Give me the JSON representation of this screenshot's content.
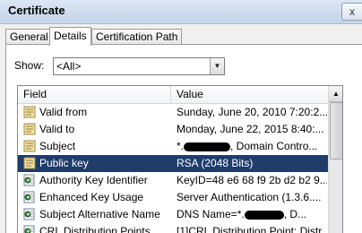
{
  "window": {
    "title": "Certificate",
    "close_label": "x"
  },
  "tabs": [
    {
      "label": "General"
    },
    {
      "label": "Details"
    },
    {
      "label": "Certification Path"
    }
  ],
  "show": {
    "label": "Show:",
    "selected": "<All>"
  },
  "list": {
    "columns": [
      "Field",
      "Value"
    ],
    "rows": [
      {
        "field": "Valid from",
        "value": "Sunday, June 20, 2010 7:20:2...",
        "icon": "cert-doc-icon"
      },
      {
        "field": "Valid to",
        "value": "Monday, June 22, 2015 8:40:...",
        "icon": "cert-doc-icon"
      },
      {
        "field": "Subject",
        "value_prefix": "*.",
        "value_suffix": ", Domain Contro...",
        "icon": "cert-doc-icon"
      },
      {
        "field": "Public key",
        "value": "RSA (2048 Bits)",
        "icon": "cert-doc-icon",
        "selected": true
      },
      {
        "field": "Authority Key Identifier",
        "value": "KeyID=48 e6 68 f9 2b d2 b2 9...",
        "icon": "extension-icon"
      },
      {
        "field": "Enhanced Key Usage",
        "value": "Server Authentication (1.3.6....",
        "icon": "extension-icon"
      },
      {
        "field": "Subject Alternative Name",
        "value_prefix": "DNS Name=*.",
        "value_suffix": ", D...",
        "icon": "extension-icon"
      },
      {
        "field": "CRL Distribution Points",
        "value": "[1]CRL Distribution Point: Distr...",
        "icon": "extension-icon"
      }
    ]
  },
  "colors": {
    "selection": "#1f3c6b",
    "titlebar": "#c4d5ea"
  }
}
